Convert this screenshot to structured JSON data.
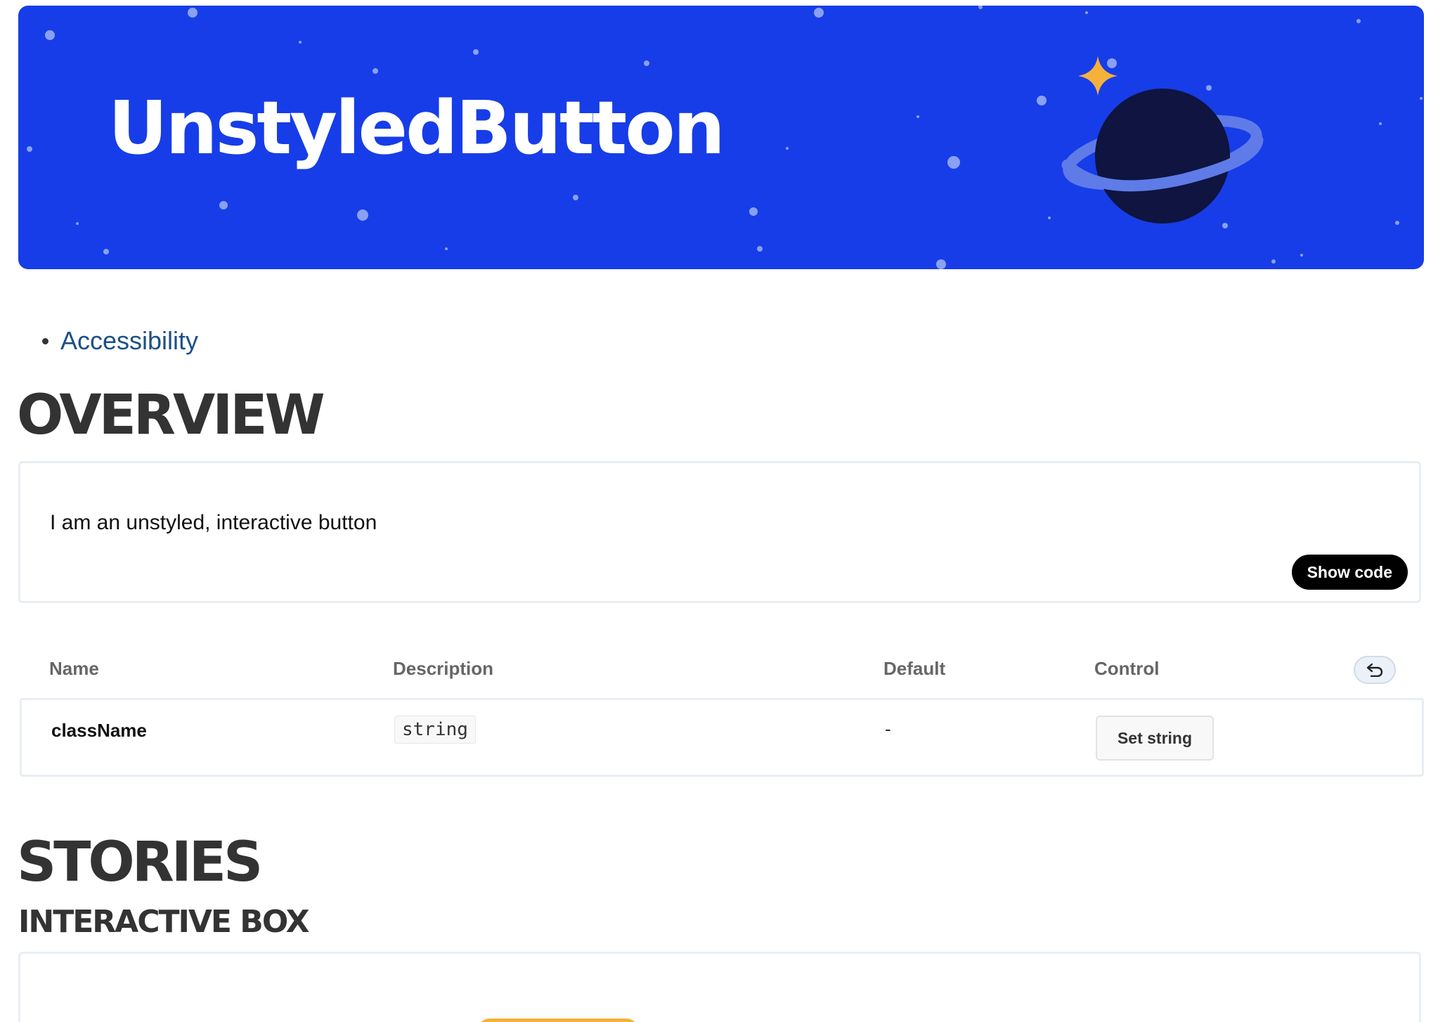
{
  "hero": {
    "title": "UnstyledButton"
  },
  "toc": {
    "items": [
      {
        "label": "Accessibility"
      }
    ]
  },
  "overview": {
    "heading": "OVERVIEW",
    "preview_text": "I am an unstyled, interactive button",
    "show_code_label": "Show code"
  },
  "args_table": {
    "headers": [
      "Name",
      "Description",
      "Default",
      "Control"
    ],
    "reset_icon": "undo-icon",
    "rows": [
      {
        "name": "className",
        "type": "string",
        "default": "-",
        "control_label": "Set string"
      }
    ]
  },
  "stories": {
    "heading": "STORIES",
    "subheading": "INTERACTIVE BOX"
  },
  "colors": {
    "hero_bg": "#173de8",
    "planet": "#0f1440",
    "ring": "#5f7be8",
    "sparkle": "#f5b13b",
    "star_dot": "#8aa0f2",
    "link": "#1d4f86",
    "story_button": "#f5b13b"
  }
}
